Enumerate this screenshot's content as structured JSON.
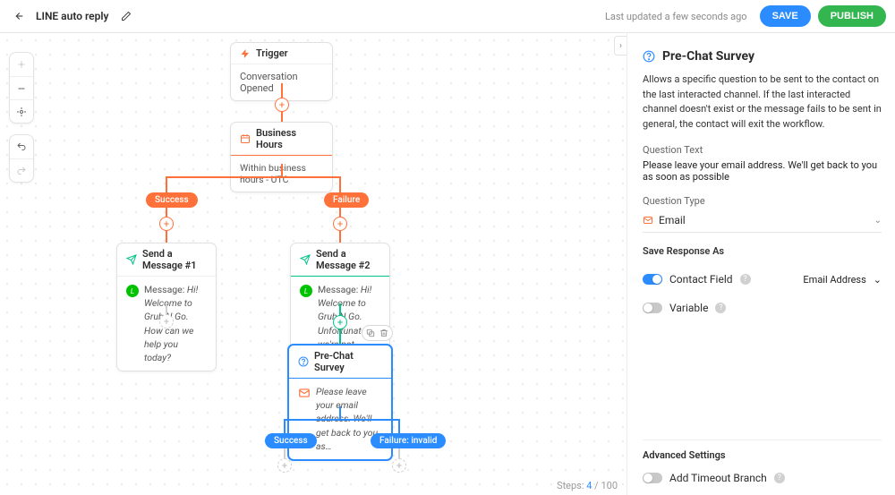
{
  "header": {
    "title": "LINE auto reply",
    "last_updated": "Last updated a few seconds ago",
    "save": "SAVE",
    "publish": "PUBLISH"
  },
  "footer": {
    "steps_label": "Steps:",
    "steps_current": "4",
    "steps_sep": " / ",
    "steps_total": "100"
  },
  "canvas": {
    "trigger": {
      "title": "Trigger",
      "body": "Conversation Opened"
    },
    "business_hours": {
      "title": "Business Hours",
      "body": "Within business hours - UTC"
    },
    "branches_bh": {
      "success": "Success",
      "failure": "Failure"
    },
    "msg1": {
      "title": "Send a Message #1",
      "prefix": "Message: ",
      "body": "Hi! Welcome to Grub N Go. How can we help you today?"
    },
    "msg2": {
      "title": "Send a Message #2",
      "prefix": "Message: ",
      "body": "Hi! Welcome to Grub N Go. Unfortunately we're not…"
    },
    "survey": {
      "title": "Pre-Chat Survey",
      "body": "Please leave your email address. We'll get back to you as…"
    },
    "branches_survey": {
      "success": "Success",
      "failure": "Failure: invalid"
    }
  },
  "panel": {
    "title": "Pre-Chat Survey",
    "description": "Allows a specific question to be sent to the contact on the last interacted channel. If the last interacted channel doesn't exist or the message fails to be sent in general, the contact will exit the workflow.",
    "question_text_label": "Question Text",
    "question_text_value": "Please leave your email address. We'll get back to you as soon as possible",
    "question_type_label": "Question Type",
    "question_type_value": "Email",
    "save_as_label": "Save Response As",
    "contact_field_label": "Contact Field",
    "contact_field_value": "Email Address",
    "variable_label": "Variable",
    "advanced_title": "Advanced Settings",
    "timeout_label": "Add Timeout Branch"
  }
}
